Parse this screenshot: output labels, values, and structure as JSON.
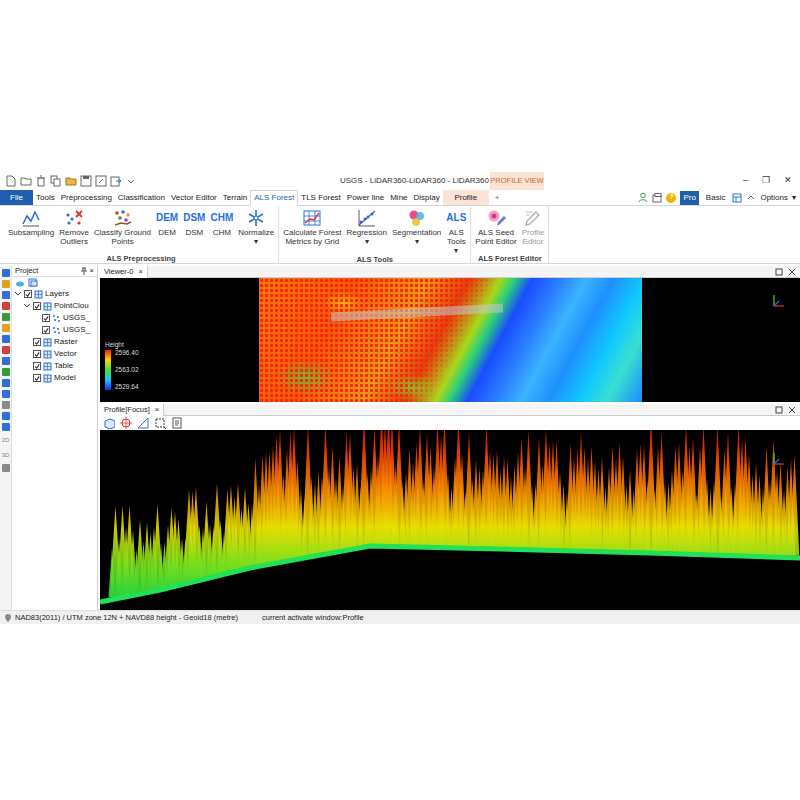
{
  "window": {
    "title": "USGS - LiDAR360-LiDAR360 - LiDAR360",
    "context_group": "PROFILE VIEW",
    "controls": [
      "–",
      "❐",
      "✕"
    ]
  },
  "ribbon_tabs": [
    {
      "label": "File",
      "selected": false,
      "kind": "file"
    },
    {
      "label": "Tools",
      "selected": false,
      "kind": "tab"
    },
    {
      "label": "Preprocessing",
      "selected": false,
      "kind": "tab"
    },
    {
      "label": "Classification",
      "selected": false,
      "kind": "tab"
    },
    {
      "label": "Vector Editor",
      "selected": false,
      "kind": "tab"
    },
    {
      "label": "Terrain",
      "selected": false,
      "kind": "tab"
    },
    {
      "label": "ALS Forest",
      "selected": true,
      "kind": "tab"
    },
    {
      "label": "TLS Forest",
      "selected": false,
      "kind": "tab"
    },
    {
      "label": "Power line",
      "selected": false,
      "kind": "tab"
    },
    {
      "label": "Mine",
      "selected": false,
      "kind": "tab"
    },
    {
      "label": "Display",
      "selected": false,
      "kind": "tab"
    },
    {
      "label": "Profile",
      "selected": false,
      "kind": "context"
    },
    {
      "label": "+",
      "selected": false,
      "kind": "add"
    }
  ],
  "toolbar_right": {
    "help": "?",
    "modes": [
      {
        "label": "Pro",
        "selected": true
      },
      {
        "label": "Basic",
        "selected": false
      }
    ],
    "options": "Options",
    "options_glyph": "▾"
  },
  "ribbon": {
    "dropdown_glyph": "▾",
    "groups": [
      {
        "title": "ALS Preprocessing",
        "buttons": [
          {
            "lines": [
              "Subsampling"
            ],
            "kind": "graphic",
            "dropdown": false,
            "disabled": false
          },
          {
            "lines": [
              "Remove",
              "Outliers"
            ],
            "kind": "graphic",
            "dropdown": false,
            "disabled": false
          },
          {
            "lines": [
              "Classify Ground",
              "Points"
            ],
            "kind": "graphic",
            "dropdown": false,
            "disabled": false
          },
          {
            "lines": [
              "DEM"
            ],
            "kind": "text-icon",
            "icon_text": "DEM",
            "dropdown": false,
            "disabled": false
          },
          {
            "lines": [
              "DSM"
            ],
            "kind": "text-icon",
            "icon_text": "DSM",
            "dropdown": false,
            "disabled": false
          },
          {
            "lines": [
              "CHM"
            ],
            "kind": "text-icon",
            "icon_text": "CHM",
            "dropdown": false,
            "disabled": false
          },
          {
            "lines": [
              "Normalize"
            ],
            "kind": "graphic",
            "dropdown": true,
            "disabled": false
          }
        ]
      },
      {
        "title": "ALS Tools",
        "buttons": [
          {
            "lines": [
              "Calculate Forest",
              "Metrics by Grid"
            ],
            "kind": "graphic",
            "dropdown": false,
            "disabled": false
          },
          {
            "lines": [
              "Regression"
            ],
            "kind": "graphic",
            "dropdown": true,
            "disabled": false
          },
          {
            "lines": [
              "Segmentation"
            ],
            "kind": "graphic",
            "dropdown": true,
            "disabled": false
          },
          {
            "lines": [
              "ALS",
              "Tools"
            ],
            "kind": "text-icon",
            "icon_text": "ALS",
            "dropdown": true,
            "disabled": false
          }
        ]
      },
      {
        "title": "ALS Forest Editor",
        "buttons": [
          {
            "lines": [
              "ALS Seed",
              "Point Editor"
            ],
            "kind": "graphic",
            "dropdown": false,
            "disabled": false
          },
          {
            "lines": [
              "Profile",
              "Editor"
            ],
            "kind": "graphic",
            "dropdown": false,
            "disabled": true
          }
        ]
      }
    ]
  },
  "left_toolbar": [
    {
      "kind": "icon",
      "color": "#2f6fd6"
    },
    {
      "kind": "icon",
      "color": "#e0a020"
    },
    {
      "kind": "icon",
      "color": "#2f6fd6"
    },
    {
      "kind": "icon",
      "color": "#d04040"
    },
    {
      "kind": "icon",
      "color": "#3a9a3a"
    },
    {
      "kind": "icon",
      "color": "#e0a020"
    },
    {
      "kind": "icon",
      "color": "#2f6fd6"
    },
    {
      "kind": "icon",
      "color": "#d04040"
    },
    {
      "kind": "icon",
      "color": "#2f6fd6"
    },
    {
      "kind": "icon",
      "color": "#3a9a3a"
    },
    {
      "kind": "icon",
      "color": "#2f6fd6"
    },
    {
      "kind": "icon",
      "color": "#2f6fd6"
    },
    {
      "kind": "icon",
      "color": "#8a8a8a"
    },
    {
      "kind": "icon",
      "color": "#2f6fd6"
    },
    {
      "kind": "icon",
      "color": "#2f6fd6"
    },
    {
      "kind": "text",
      "label": "2D"
    },
    {
      "kind": "text",
      "label": "3D"
    },
    {
      "kind": "icon",
      "color": "#8a8a8a"
    }
  ],
  "project": {
    "title": "Project",
    "close": "×",
    "tree": [
      {
        "label": "Layers",
        "level": 0,
        "kind": "group",
        "expanded": true,
        "checked": true
      },
      {
        "label": "PointClou",
        "level": 1,
        "kind": "group",
        "expanded": true,
        "checked": true
      },
      {
        "label": "USGS_",
        "level": 2,
        "kind": "leaf",
        "checked": true
      },
      {
        "label": "USGS_",
        "level": 2,
        "kind": "leaf",
        "checked": true
      },
      {
        "label": "Raster",
        "level": 1,
        "kind": "leaf",
        "checked": true
      },
      {
        "label": "Vector",
        "level": 1,
        "kind": "leaf",
        "checked": true
      },
      {
        "label": "Table",
        "level": 1,
        "kind": "leaf",
        "checked": true
      },
      {
        "label": "Model",
        "level": 1,
        "kind": "leaf",
        "checked": true
      }
    ]
  },
  "viewer": {
    "tab": "Viewer-0",
    "close": "×",
    "legend": {
      "title": "Height",
      "values": [
        "2596.40",
        "2563.02",
        "2529.64"
      ]
    }
  },
  "profile": {
    "tab": "Profile[Focus]",
    "close": "×"
  },
  "status_bar": {
    "crs": "NAD83(2011) / UTM zone 12N + NAVD88 height - Geoid18 (metre)",
    "active_window": "current activate window:Profile"
  }
}
